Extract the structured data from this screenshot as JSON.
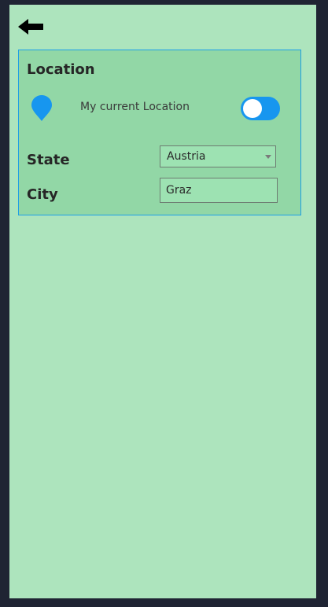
{
  "header": {
    "back_icon": "arrow-left-icon"
  },
  "location_card": {
    "title": "Location",
    "pin_icon": "map-pin-icon",
    "current_location_label": "My current Location",
    "current_location_enabled": true,
    "state_label": "State",
    "state_value": "Austria",
    "city_label": "City",
    "city_value": "Graz"
  },
  "colors": {
    "background": "#ade4bd",
    "card": "#92d7a6",
    "accent": "#1796ef"
  }
}
